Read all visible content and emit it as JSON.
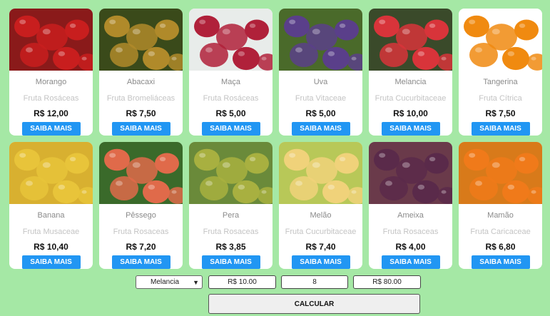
{
  "products": [
    {
      "name": "Morango",
      "family": "Fruta Rosáceas",
      "price": "R$ 12,00",
      "button": "SAIBA MAIS",
      "image": "strawberries",
      "color": "#c81e1e"
    },
    {
      "name": "Abacaxi",
      "family": "Fruta Bromeliáceas",
      "price": "R$ 7,50",
      "button": "SAIBA MAIS",
      "image": "pineapples",
      "color": "#b08a2a"
    },
    {
      "name": "Maça",
      "family": "Fruta Rosáceas",
      "price": "R$ 5,00",
      "button": "SAIBA MAIS",
      "image": "apples",
      "color": "#b0213a"
    },
    {
      "name": "Uva",
      "family": "Fruta Vitaceae",
      "price": "R$ 5,00",
      "button": "SAIBA MAIS",
      "image": "grapes",
      "color": "#5a3f8a"
    },
    {
      "name": "Melancia",
      "family": "Fruta Cucurbitaceae",
      "price": "R$ 10,00",
      "button": "SAIBA MAIS",
      "image": "watermelon",
      "color": "#d8343a"
    },
    {
      "name": "Tangerina",
      "family": "Fruta Cítrica",
      "price": "R$ 7,50",
      "button": "SAIBA MAIS",
      "image": "tangerines",
      "color": "#f08a10"
    },
    {
      "name": "Banana",
      "family": "Fruta Musaceae",
      "price": "R$ 10,40",
      "button": "SAIBA MAIS",
      "image": "bananas",
      "color": "#e8c43a"
    },
    {
      "name": "Pêssego",
      "family": "Fruta Rosaceas",
      "price": "R$ 7,20",
      "button": "SAIBA MAIS",
      "image": "peaches",
      "color": "#e06a4a"
    },
    {
      "name": "Pera",
      "family": "Fruta Rosaceas",
      "price": "R$ 3,85",
      "button": "SAIBA MAIS",
      "image": "pears",
      "color": "#a8b040"
    },
    {
      "name": "Melão",
      "family": "Fruta Cucurbitaceae",
      "price": "R$ 7,40",
      "button": "SAIBA MAIS",
      "image": "melon",
      "color": "#f0d27a"
    },
    {
      "name": "Ameixa",
      "family": "Fruta Rosaceas",
      "price": "R$ 4,00",
      "button": "SAIBA MAIS",
      "image": "plums",
      "color": "#5a2a4a"
    },
    {
      "name": "Mamão",
      "family": "Fruta Caricaceae",
      "price": "R$ 6,80",
      "button": "SAIBA MAIS",
      "image": "papaya",
      "color": "#f07a1a"
    }
  ],
  "calculator": {
    "selected_fruit": "Melancia",
    "unit_price": "R$ 10.00",
    "quantity": "8",
    "total": "R$ 80.00",
    "calculate_label": "CALCULAR"
  }
}
